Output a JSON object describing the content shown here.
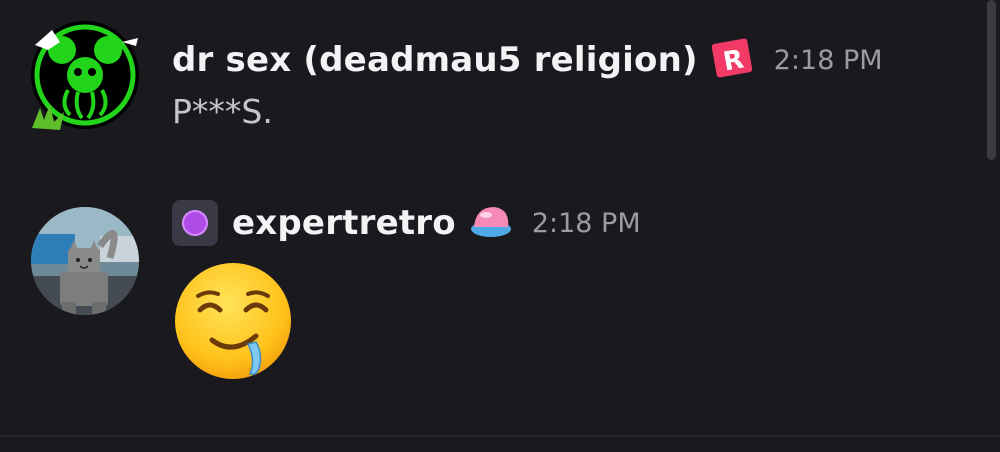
{
  "messages": [
    {
      "username": "dr sex (deadmau5 religion)",
      "badge_icon": "roblox-logo-icon",
      "timestamp": "2:18 PM",
      "text": "P***S.",
      "avatar_icon": "green-deadmau5-avatar",
      "colors": {
        "name": "#f2f3f5",
        "text": "#c4c6cc",
        "avatar_accent": "#22d41a"
      }
    },
    {
      "username": "expertretro",
      "role_icon": "purple-circle-icon",
      "badge_icon": "pink-cap-icon",
      "timestamp": "2:18 PM",
      "emoji": "drooling-face-emoji",
      "avatar_icon": "gray-cat-avatar",
      "colors": {
        "role": "#b04be8",
        "timestamp": "#9a9ca3"
      }
    }
  ],
  "theme": {
    "background": "#1a1a1e",
    "scrollbar": "#3a3a40"
  }
}
